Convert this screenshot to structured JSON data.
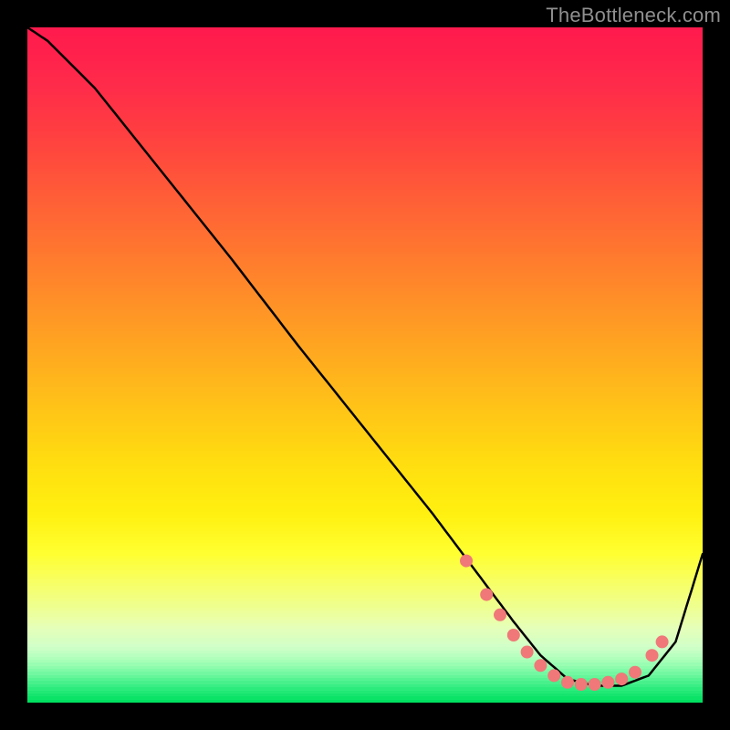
{
  "watermark": "TheBottleneck.com",
  "colors": {
    "background": "#000000",
    "curve_stroke": "#000000",
    "point_fill": "#f07878",
    "gradient_top": "#ff1a4d",
    "gradient_mid": "#ffd200",
    "gradient_bottom": "#00e060"
  },
  "chart_data": {
    "type": "line",
    "title": "",
    "xlabel": "",
    "ylabel": "",
    "xlim": [
      0,
      100
    ],
    "ylim": [
      0,
      100
    ],
    "x": [
      0,
      3,
      6,
      10,
      20,
      30,
      40,
      50,
      60,
      66,
      72,
      76,
      80,
      84,
      88,
      92,
      96,
      100
    ],
    "values": [
      100,
      98,
      95,
      91,
      78.5,
      66,
      53,
      40.5,
      28,
      20,
      12,
      7,
      3.5,
      2.5,
      2.5,
      4,
      9,
      22
    ],
    "highlight_points": [
      {
        "x": 65,
        "y": 21
      },
      {
        "x": 68,
        "y": 16
      },
      {
        "x": 70,
        "y": 13
      },
      {
        "x": 72,
        "y": 10
      },
      {
        "x": 74,
        "y": 7.5
      },
      {
        "x": 76,
        "y": 5.5
      },
      {
        "x": 78,
        "y": 4
      },
      {
        "x": 80,
        "y": 3
      },
      {
        "x": 82,
        "y": 2.7
      },
      {
        "x": 84,
        "y": 2.7
      },
      {
        "x": 86,
        "y": 3
      },
      {
        "x": 88,
        "y": 3.5
      },
      {
        "x": 90,
        "y": 4.5
      },
      {
        "x": 92.5,
        "y": 7
      },
      {
        "x": 94,
        "y": 9
      }
    ],
    "gradient_stops": [
      {
        "pos": 0.0,
        "color": "#ff1a4d"
      },
      {
        "pos": 0.08,
        "color": "#ff2a4a"
      },
      {
        "pos": 0.16,
        "color": "#ff4040"
      },
      {
        "pos": 0.24,
        "color": "#ff5a38"
      },
      {
        "pos": 0.32,
        "color": "#ff7430"
      },
      {
        "pos": 0.4,
        "color": "#ff8e28"
      },
      {
        "pos": 0.48,
        "color": "#ffa820"
      },
      {
        "pos": 0.56,
        "color": "#ffc218"
      },
      {
        "pos": 0.64,
        "color": "#ffdc10"
      },
      {
        "pos": 0.72,
        "color": "#fff010"
      },
      {
        "pos": 0.78,
        "color": "#ffff30"
      },
      {
        "pos": 0.82,
        "color": "#f8ff60"
      },
      {
        "pos": 0.86,
        "color": "#efff90"
      },
      {
        "pos": 0.89,
        "color": "#e6ffb8"
      },
      {
        "pos": 0.92,
        "color": "#d0ffc8"
      },
      {
        "pos": 0.94,
        "color": "#a8ffb8"
      },
      {
        "pos": 0.96,
        "color": "#70f8a0"
      },
      {
        "pos": 0.98,
        "color": "#30ec80"
      },
      {
        "pos": 1.0,
        "color": "#00e060"
      }
    ]
  }
}
